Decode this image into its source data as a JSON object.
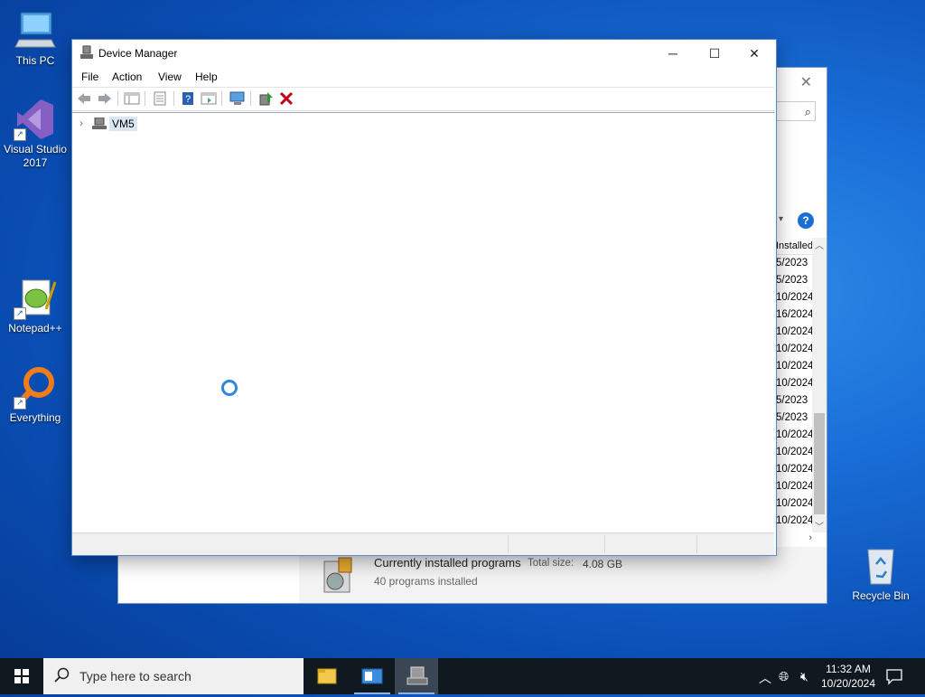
{
  "desktop": {
    "icons": [
      {
        "label": "This PC"
      },
      {
        "label": "Visual Studio 2017"
      },
      {
        "label": "Notepad++"
      },
      {
        "label": "Everything"
      },
      {
        "label": "Recycle Bin"
      }
    ]
  },
  "programs_window": {
    "column_header": "Installed On",
    "dates": [
      "5/2023",
      "5/2023",
      "10/2024",
      "16/2024",
      "10/2024",
      "10/2024",
      "10/2024",
      "10/2024",
      "5/2023",
      "5/2023",
      "10/2024",
      "10/2024",
      "10/2024",
      "10/2024",
      "10/2024",
      "10/2024"
    ],
    "footer": {
      "title": "Currently installed programs",
      "total_label": "Total size:",
      "total_value": "4.08 GB",
      "count": "40 programs installed"
    }
  },
  "device_manager": {
    "title": "Device Manager",
    "menu": [
      "File",
      "Action",
      "View",
      "Help"
    ],
    "tree_root": "VM5"
  },
  "taskbar": {
    "search_placeholder": "Type here to search",
    "time": "11:32 AM",
    "date": "10/20/2024"
  }
}
